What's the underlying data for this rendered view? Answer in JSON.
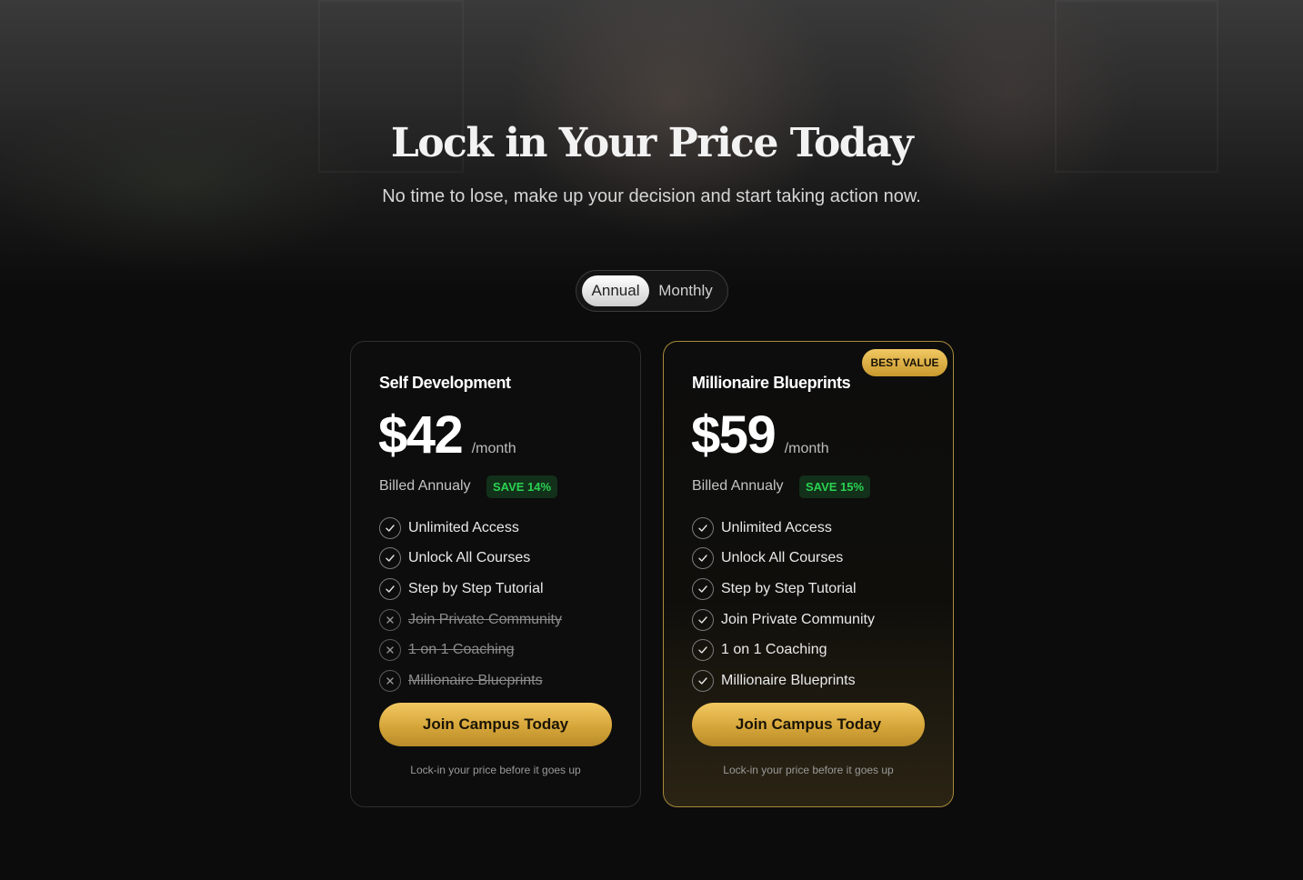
{
  "hero": {
    "title": "Lock in Your Price Today",
    "subtitle": "No time to lose, make up your decision and start taking action now."
  },
  "billing_toggle": {
    "options": [
      "Annual",
      "Monthly"
    ],
    "selected": "Annual"
  },
  "plans": [
    {
      "name": "Self Development",
      "price": "$42",
      "period": "/month",
      "billed": "Billed Annualy",
      "save_badge": "SAVE 14%",
      "features": [
        {
          "label": "Unlimited Access",
          "included": true
        },
        {
          "label": "Unlock All Courses",
          "included": true
        },
        {
          "label": "Step by Step Tutorial",
          "included": true
        },
        {
          "label": "Join Private Community",
          "included": false
        },
        {
          "label": "1 on 1 Coaching",
          "included": false
        },
        {
          "label": "Millionaire Blueprints",
          "included": false
        }
      ],
      "cta": "Join Campus Today",
      "note": "Lock-in your price before it goes up"
    },
    {
      "name": "Millionaire Blueprints",
      "badge": "BEST VALUE",
      "price": "$59",
      "period": "/month",
      "billed": "Billed Annualy",
      "save_badge": "SAVE 15%",
      "features": [
        {
          "label": "Unlimited Access",
          "included": true
        },
        {
          "label": "Unlock All Courses",
          "included": true
        },
        {
          "label": "Step by Step Tutorial",
          "included": true
        },
        {
          "label": "Join Private Community",
          "included": true
        },
        {
          "label": "1 on 1 Coaching",
          "included": true
        },
        {
          "label": "Millionaire Blueprints",
          "included": true
        }
      ],
      "cta": "Join Campus Today",
      "note": "Lock-in your price before it goes up"
    }
  ],
  "colors": {
    "background": "#0c0c0c",
    "gold_accent": "#d6a63a",
    "save_green": "#2bd251",
    "best_value_border": "#a88a3c"
  },
  "icons": {
    "included": "check-icon",
    "excluded": "close-icon"
  }
}
